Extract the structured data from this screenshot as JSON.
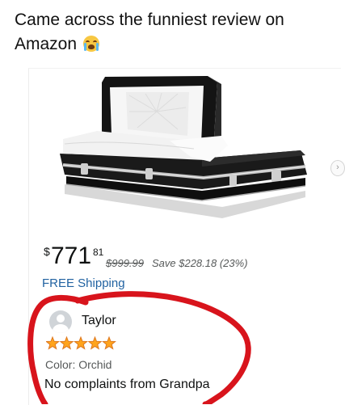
{
  "post": {
    "caption": "Came across the funniest review on Amazon",
    "emoji": "loudly-crying-face-emoji"
  },
  "product": {
    "image": "casket-image",
    "price_symbol": "$",
    "price_whole": "771",
    "price_fraction": "81",
    "list_price": "$999.99",
    "savings": "Save $228.18 (23%)",
    "shipping": "FREE Shipping"
  },
  "review": {
    "reviewer_name": "Taylor",
    "rating": 5,
    "rating_max": 5,
    "color_variant": "Color: Orchid",
    "text": "No complaints from Grandpa"
  },
  "colors": {
    "link": "#2162a1",
    "star": "#ffa41c",
    "annotation_red": "#d8141c",
    "casket": "#121212"
  },
  "icons": {
    "carousel_next": "chevron-right-icon",
    "avatar": "default-user-avatar-icon",
    "star": "star-icon"
  }
}
